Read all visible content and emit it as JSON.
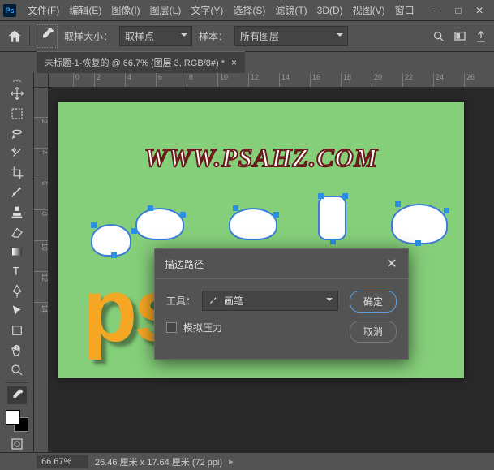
{
  "menu": {
    "file": "文件(F)",
    "edit": "编辑(E)",
    "image": "图像(I)",
    "layer": "图层(L)",
    "text": "文字(Y)",
    "select": "选择(S)",
    "filter": "滤镜(T)",
    "threeD": "3D(D)",
    "view": "视图(V)",
    "window": "窗口"
  },
  "options": {
    "sample_size_label": "取样大小：",
    "sample_size_value": "取样点",
    "sample_label": "样本：",
    "sample_value": "所有图层"
  },
  "document": {
    "tab_title": "未标题-1-恢复的 @ 66.7% (图层 3, RGB/8#) *"
  },
  "ruler_h": [
    "0",
    "2",
    "4",
    "6",
    "8",
    "10",
    "12",
    "14",
    "16",
    "18",
    "20",
    "22",
    "24",
    "26"
  ],
  "ruler_v": [
    "",
    "2",
    "4",
    "6",
    "8",
    "10",
    "12",
    "14"
  ],
  "canvas": {
    "watermark": "WWW.PSAHZ.COM",
    "text": "psahz"
  },
  "dialog": {
    "title": "描边路径",
    "tool_label": "工具：",
    "tool_value": "画笔",
    "simulate_pressure": "模拟压力",
    "ok": "确定",
    "cancel": "取消"
  },
  "status": {
    "zoom": "66.67%",
    "dimensions": "26.46 厘米 x 17.64 厘米 (72 ppi)"
  }
}
